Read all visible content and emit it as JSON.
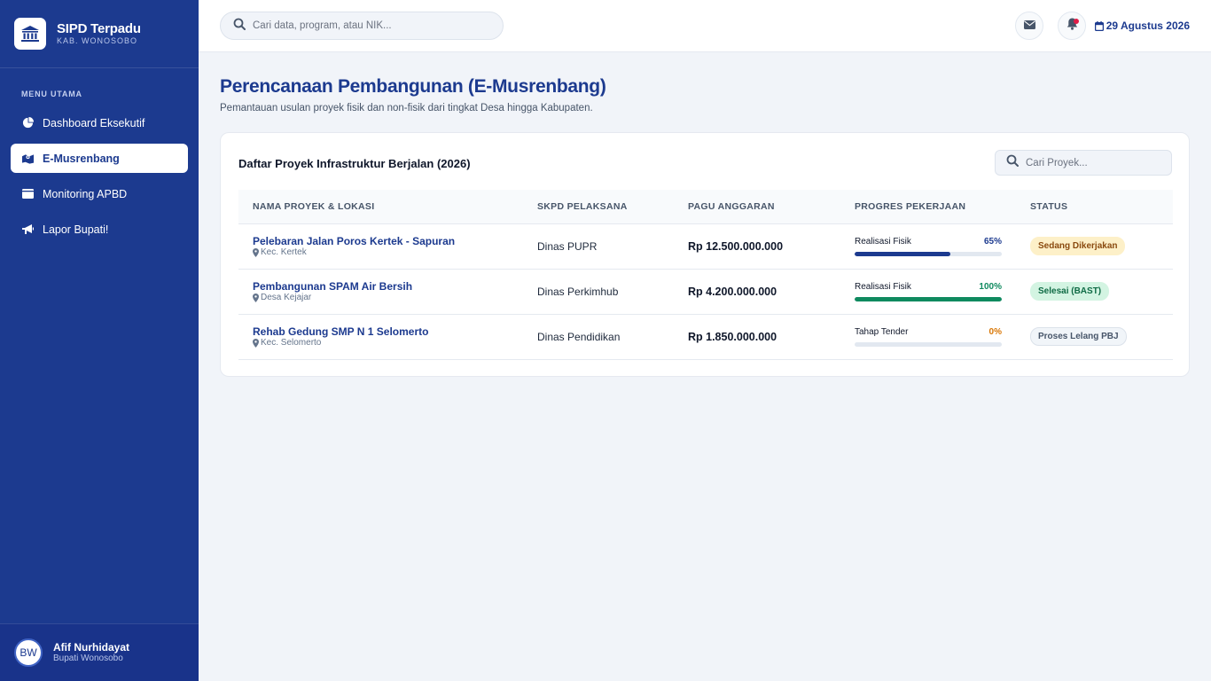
{
  "brand": {
    "title": "SIPD Terpadu",
    "subtitle": "KAB. WONOSOBO"
  },
  "sidebar": {
    "heading": "MENU UTAMA",
    "items": [
      {
        "label": "Dashboard Eksekutif",
        "icon": "pie-chart-icon",
        "active": false
      },
      {
        "label": "E-Musrenbang",
        "icon": "map-icon",
        "active": true
      },
      {
        "label": "Monitoring APBD",
        "icon": "wallet-icon",
        "active": false
      },
      {
        "label": "Lapor Bupati!",
        "icon": "megaphone-icon",
        "active": false
      }
    ]
  },
  "user": {
    "initials": "BW",
    "name": "Afif Nurhidayat",
    "role": "Bupati Wonosobo"
  },
  "topbar": {
    "search_placeholder": "Cari data, program, atau NIK...",
    "date": "29 Agustus 2026",
    "has_notification": true
  },
  "page": {
    "title": "Perencanaan Pembangunan (E-Musrenbang)",
    "subtitle": "Pemantauan usulan proyek fisik dan non-fisik dari tingkat Desa hingga Kabupaten."
  },
  "card": {
    "title": "Daftar Proyek Infrastruktur Berjalan (2026)",
    "search_placeholder": "Cari Proyek..."
  },
  "table": {
    "headers": [
      "NAMA PROYEK & LOKASI",
      "SKPD PELAKSANA",
      "PAGU ANGGARAN",
      "PROGRES PEKERJAAN",
      "STATUS"
    ],
    "rows": [
      {
        "name": "Pelebaran Jalan Poros Kertek - Sapuran",
        "location": "Kec. Kertek",
        "skpd": "Dinas PUPR",
        "budget": "Rp 12.500.000.000",
        "progress_label": "Realisasi Fisik",
        "progress_text": "65%",
        "progress": 65,
        "progress_color": "#1c3a8f",
        "status": "Sedang Dikerjakan",
        "status_bg": "#fdf0c8",
        "status_fg": "#8a4a0f",
        "status_border": "#fdf0c8"
      },
      {
        "name": "Pembangunan SPAM Air Bersih",
        "location": "Desa Kejajar",
        "skpd": "Dinas Perkimhub",
        "budget": "Rp 4.200.000.000",
        "progress_label": "Realisasi Fisik",
        "progress_text": "100%",
        "progress": 100,
        "progress_color": "#0f8a5f",
        "status": "Selesai (BAST)",
        "status_bg": "#d3f4e2",
        "status_fg": "#0f6b45",
        "status_border": "#d3f4e2"
      },
      {
        "name": "Rehab Gedung SMP N 1 Selomerto",
        "location": "Kec. Selomerto",
        "skpd": "Dinas Pendidikan",
        "budget": "Rp 1.850.000.000",
        "progress_label": "Tahap Tender",
        "progress_text": "0%",
        "progress": 0,
        "progress_color": "#d97706",
        "status": "Proses Lelang PBJ",
        "status_bg": "#f1f5f9",
        "status_fg": "#475569",
        "status_border": "#dbe2ea"
      }
    ]
  }
}
